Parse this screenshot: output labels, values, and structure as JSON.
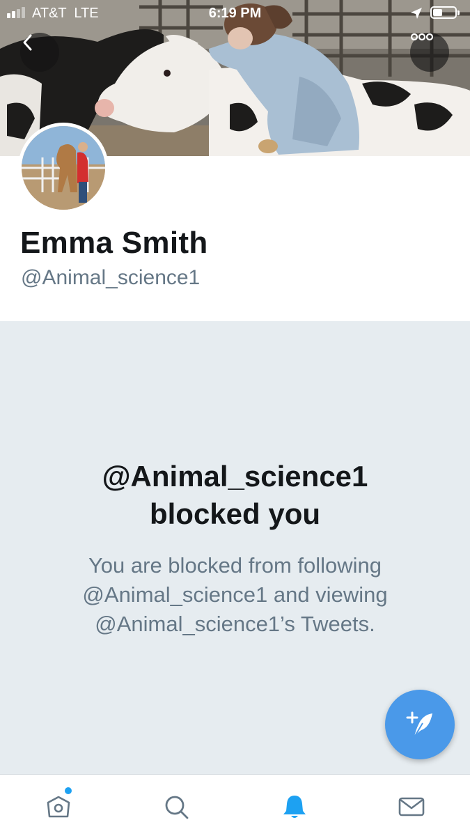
{
  "status_bar": {
    "carrier": "AT&T  LTE",
    "time": "6:19 PM",
    "icons": [
      "signal-icon",
      "location-arrow-icon",
      "battery-icon"
    ]
  },
  "header": {
    "back_icon": "chevron-left-icon",
    "more_icon": "more-dots-icon"
  },
  "profile": {
    "name": "Emma Smith",
    "handle": "@Animal_science1"
  },
  "blocked": {
    "title_line1": "@Animal_science1",
    "title_line2": "blocked you",
    "message": "You are blocked from following @Animal_science1 and viewing @Animal_science1’s Tweets."
  },
  "compose": {
    "icon": "compose-tweet-icon",
    "color": "#4a99e9"
  },
  "tab_bar": {
    "items": [
      {
        "name": "home",
        "icon": "home-icon",
        "active": false,
        "has_unread_dot": true
      },
      {
        "name": "search",
        "icon": "search-icon",
        "active": false
      },
      {
        "name": "notifications",
        "icon": "bell-icon",
        "active": true
      },
      {
        "name": "messages",
        "icon": "envelope-icon",
        "active": false
      }
    ],
    "active_color": "#1da1f2",
    "inactive_color": "#657786"
  },
  "colors": {
    "blocked_background": "#e6ecf0",
    "text_primary": "#14171a",
    "text_secondary": "#657786"
  }
}
